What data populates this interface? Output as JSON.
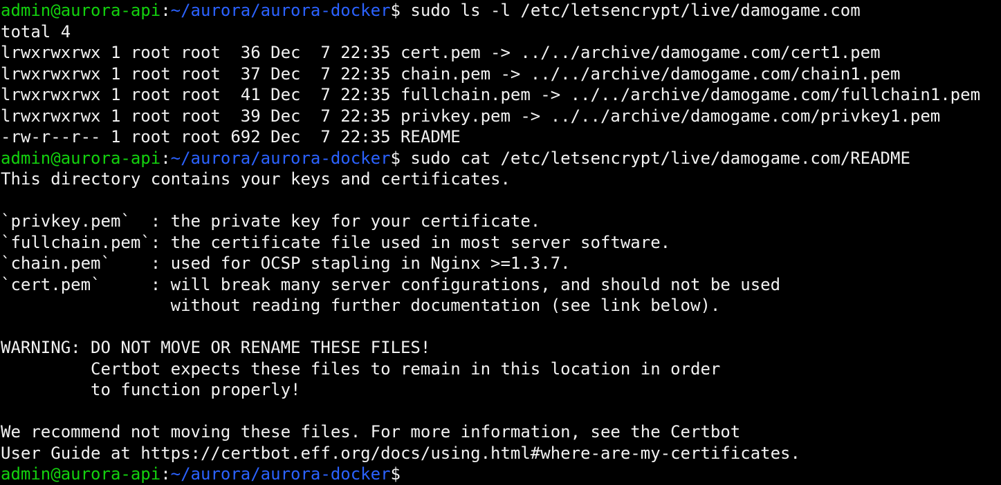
{
  "terminal": {
    "colors": {
      "background": "#000000",
      "text": "#f2f2f2",
      "prompt_user": "#13d10e",
      "prompt_path": "#2b62ff"
    },
    "prompt": {
      "user_host": "admin@aurora-api",
      "separator": ":",
      "path": "~/aurora/aurora-docker",
      "symbol": "$"
    },
    "lines": [
      {
        "type": "prompt",
        "cmd": " sudo ls -l /etc/letsencrypt/live/damogame.com"
      },
      {
        "type": "output",
        "text": "total 4"
      },
      {
        "type": "output",
        "text": "lrwxrwxrwx 1 root root  36 Dec  7 22:35 cert.pem -> ../../archive/damogame.com/cert1.pem"
      },
      {
        "type": "output",
        "text": "lrwxrwxrwx 1 root root  37 Dec  7 22:35 chain.pem -> ../../archive/damogame.com/chain1.pem"
      },
      {
        "type": "output",
        "text": "lrwxrwxrwx 1 root root  41 Dec  7 22:35 fullchain.pem -> ../../archive/damogame.com/fullchain1.pem"
      },
      {
        "type": "output",
        "text": "lrwxrwxrwx 1 root root  39 Dec  7 22:35 privkey.pem -> ../../archive/damogame.com/privkey1.pem"
      },
      {
        "type": "output",
        "text": "-rw-r--r-- 1 root root 692 Dec  7 22:35 README"
      },
      {
        "type": "prompt",
        "cmd": " sudo cat /etc/letsencrypt/live/damogame.com/README"
      },
      {
        "type": "output",
        "text": "This directory contains your keys and certificates."
      },
      {
        "type": "output",
        "text": ""
      },
      {
        "type": "output",
        "text": "`privkey.pem`  : the private key for your certificate."
      },
      {
        "type": "output",
        "text": "`fullchain.pem`: the certificate file used in most server software."
      },
      {
        "type": "output",
        "text": "`chain.pem`    : used for OCSP stapling in Nginx >=1.3.7."
      },
      {
        "type": "output",
        "text": "`cert.pem`     : will break many server configurations, and should not be used"
      },
      {
        "type": "output",
        "text": "                 without reading further documentation (see link below)."
      },
      {
        "type": "output",
        "text": ""
      },
      {
        "type": "output",
        "text": "WARNING: DO NOT MOVE OR RENAME THESE FILES!"
      },
      {
        "type": "output",
        "text": "         Certbot expects these files to remain in this location in order"
      },
      {
        "type": "output",
        "text": "         to function properly!"
      },
      {
        "type": "output",
        "text": ""
      },
      {
        "type": "output",
        "text": "We recommend not moving these files. For more information, see the Certbot"
      },
      {
        "type": "output",
        "text": "User Guide at https://certbot.eff.org/docs/using.html#where-are-my-certificates."
      },
      {
        "type": "prompt",
        "cmd": ""
      }
    ]
  }
}
